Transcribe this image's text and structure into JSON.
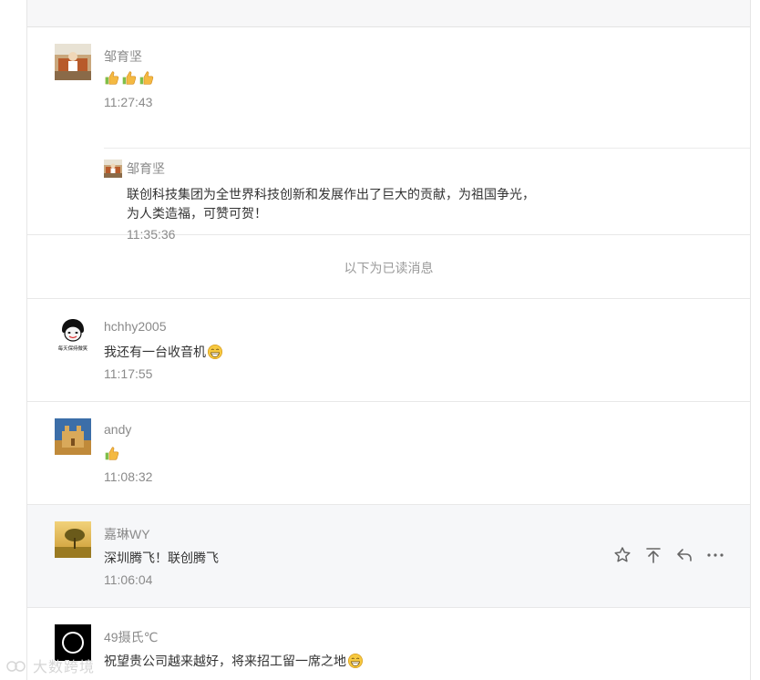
{
  "read_divider": "以下为已读消息",
  "comments": [
    {
      "user": "邹育坚",
      "emoji_count": 3,
      "time": "11:27:43",
      "reply": {
        "user": "邹育坚",
        "text_line1": "联创科技集团为全世界科技创新和发展作出了巨大的贡献，为祖国争光，",
        "text_line2": "为人类造福，可赞可贺！",
        "time": "11:35:36"
      }
    },
    {
      "user": "hchhy2005",
      "text": "我还有一台收音机",
      "time": "11:17:55",
      "avatar_caption": "每天保持微笑"
    },
    {
      "user": "andy",
      "emoji_count": 1,
      "time": "11:08:32"
    },
    {
      "user": "嘉琳WY",
      "text": "深圳腾飞！联创腾飞",
      "time": "11:06:04"
    },
    {
      "user": "49摄氏℃",
      "text": "祝望贵公司越来越好，将来招工留一席之地"
    }
  ],
  "actions": [
    "star-icon",
    "pin-top-icon",
    "reply-icon",
    "more-icon"
  ],
  "watermark": "大数跨境"
}
